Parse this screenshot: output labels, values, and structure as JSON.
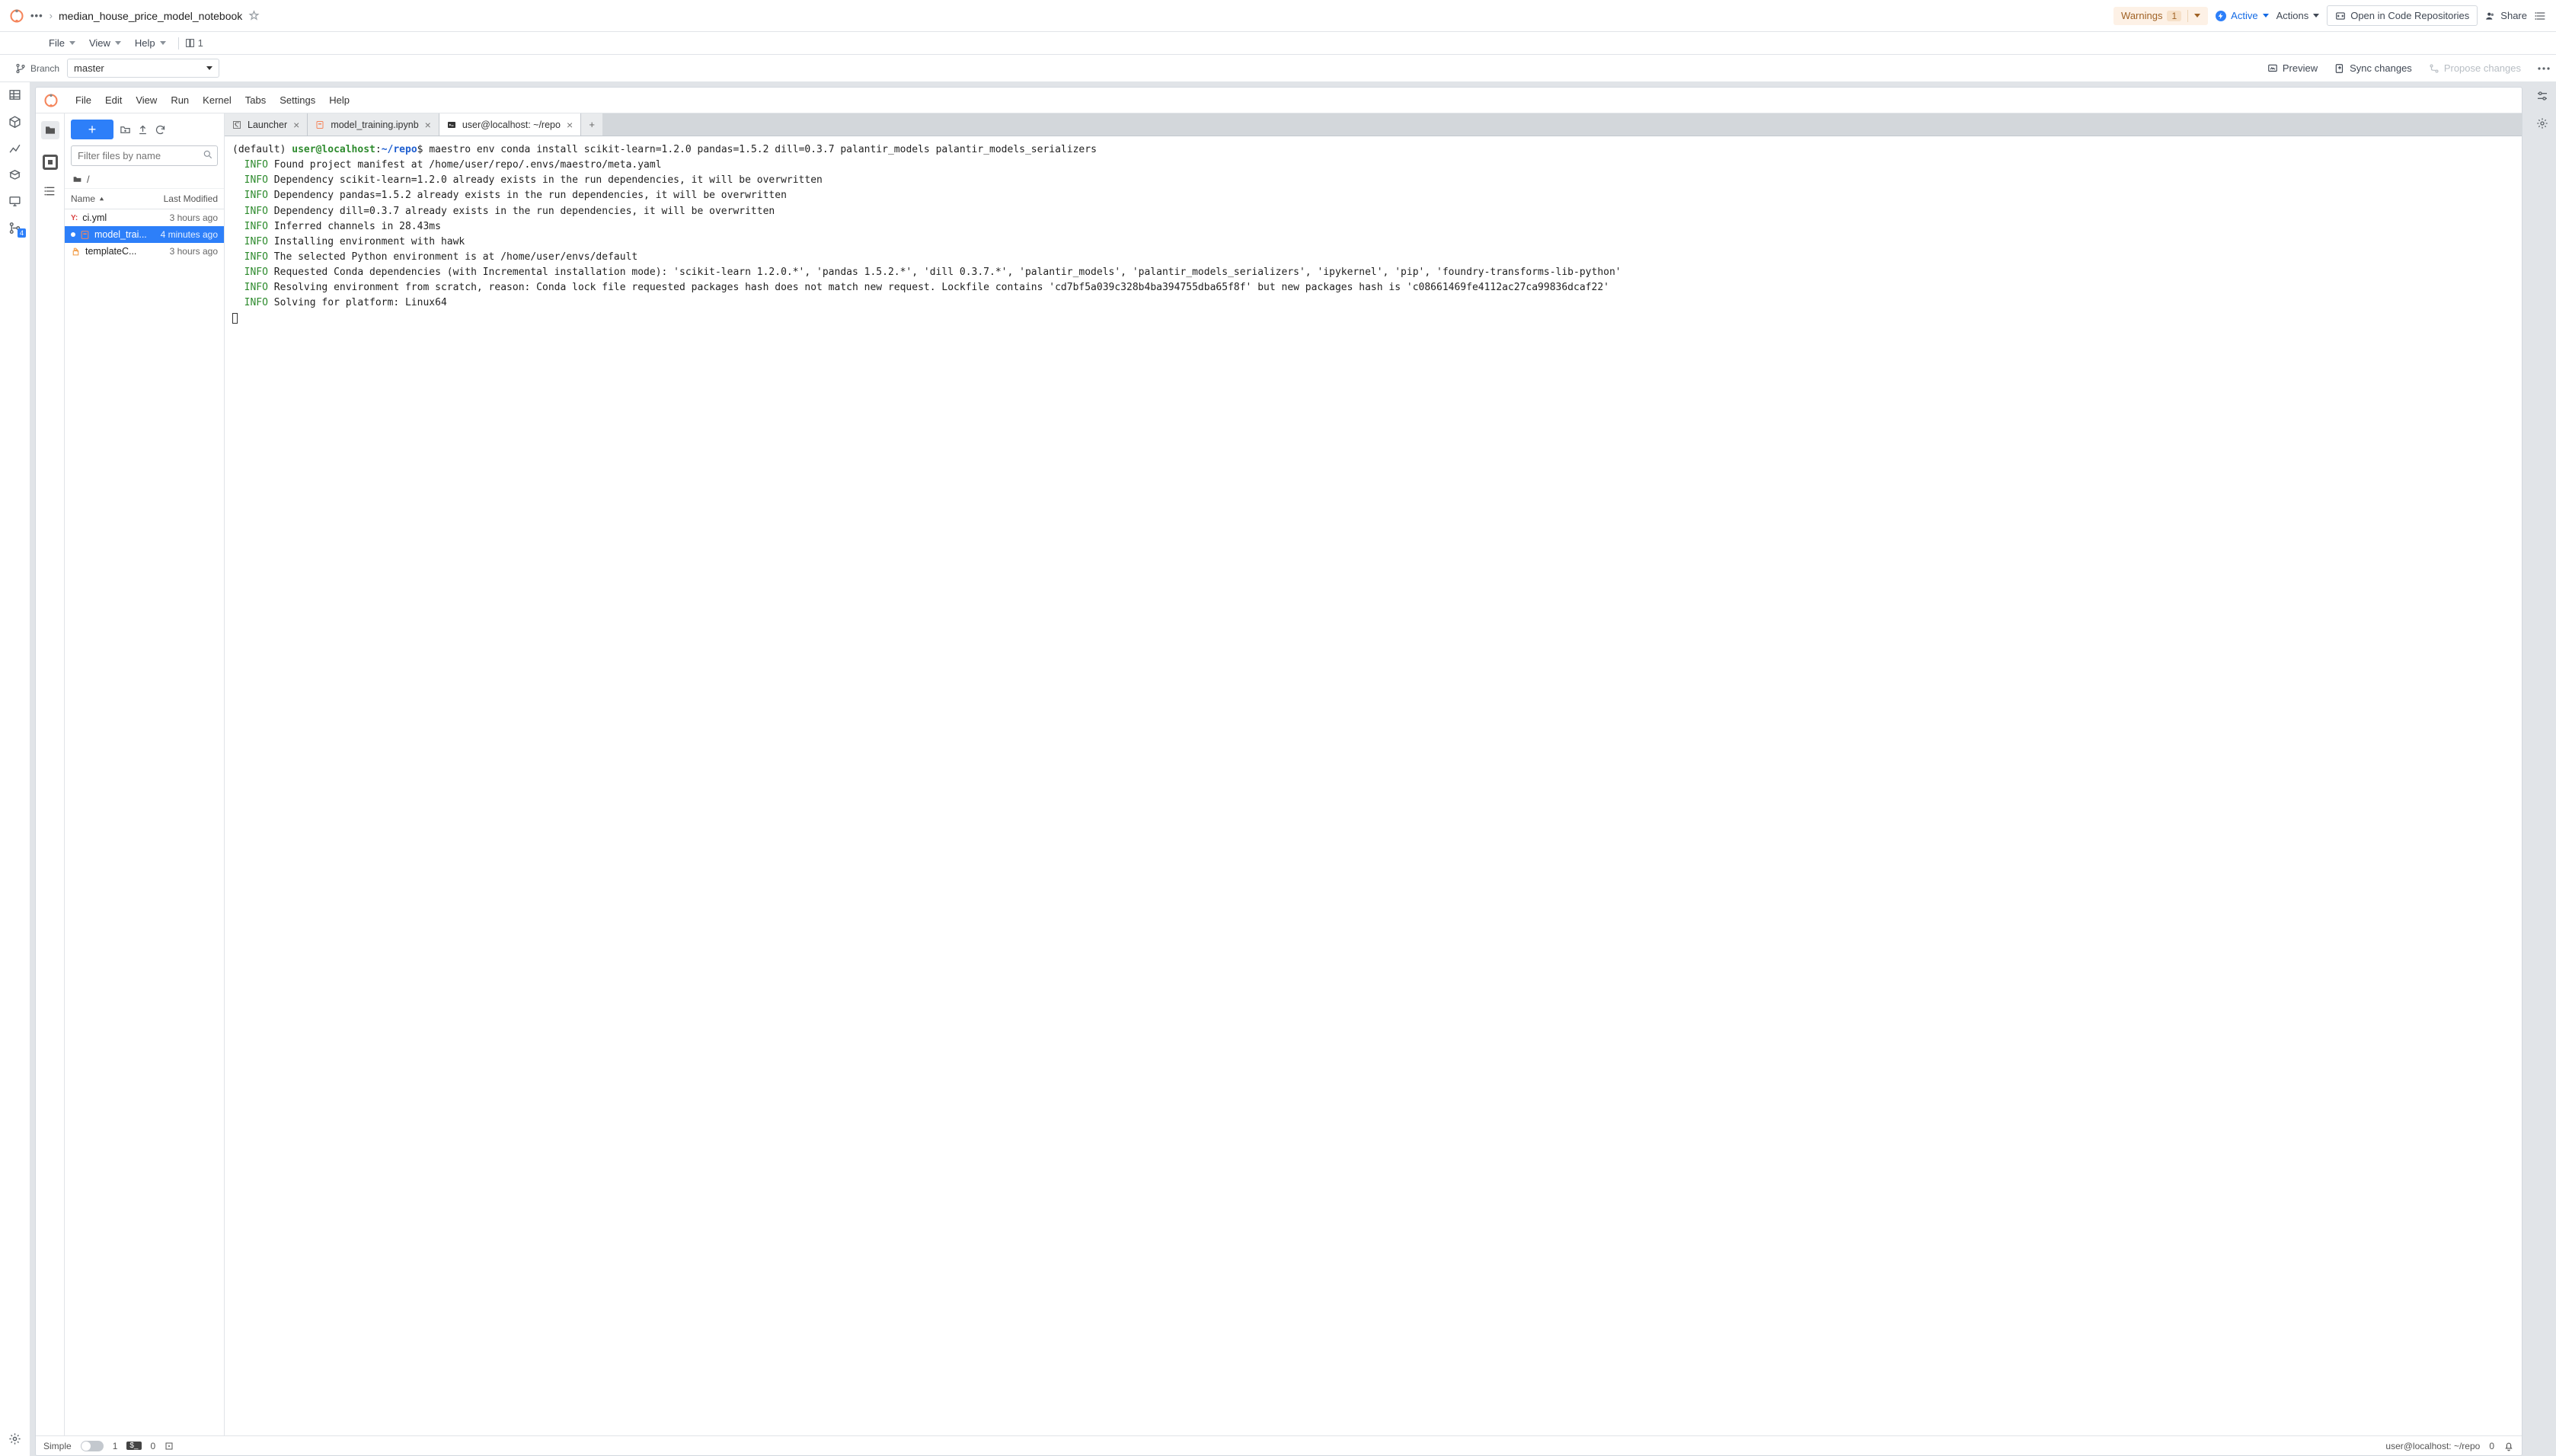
{
  "header": {
    "breadcrumb_ellipsis": "•••",
    "breadcrumb_sep": "›",
    "title": "median_house_price_model_notebook",
    "warnings_label": "Warnings",
    "warnings_count": "1",
    "active_label": "Active",
    "actions_label": "Actions",
    "open_repo_label": "Open in Code Repositories",
    "share_label": "Share"
  },
  "sub_menu": {
    "file": "File",
    "view": "View",
    "help": "Help",
    "panel_count": "1"
  },
  "branch_row": {
    "label": "Branch",
    "value": "master",
    "preview": "Preview",
    "sync": "Sync changes",
    "propose": "Propose changes"
  },
  "left_rail_badge": "4",
  "jupyter_menu": {
    "file": "File",
    "edit": "Edit",
    "view": "View",
    "run": "Run",
    "kernel": "Kernel",
    "tabs": "Tabs",
    "settings": "Settings",
    "help": "Help"
  },
  "file_browser": {
    "filter_placeholder": "Filter files by name",
    "path": "/",
    "col_name": "Name",
    "col_modified": "Last Modified",
    "files": [
      {
        "name": "ci.yml",
        "time": "3 hours ago",
        "type": "yml",
        "selected": false,
        "dirty": false
      },
      {
        "name": "model_trai...",
        "time": "4 minutes ago",
        "type": "nb",
        "selected": true,
        "dirty": true
      },
      {
        "name": "templateC...",
        "time": "3 hours ago",
        "type": "tpl",
        "selected": false,
        "dirty": false
      }
    ]
  },
  "tabs": [
    {
      "label": "Launcher",
      "icon": "launcher",
      "active": false
    },
    {
      "label": "model_training.ipynb",
      "icon": "notebook",
      "active": false
    },
    {
      "label": "user@localhost: ~/repo",
      "icon": "terminal",
      "active": true
    }
  ],
  "terminal": {
    "default_prefix": "(default) ",
    "user": "user@localhost",
    "colon": ":",
    "path": "~/repo",
    "prompt": "$",
    "command": "maestro env conda install scikit-learn=1.2.0 pandas=1.5.2 dill=0.3.7 palantir_models palantir_models_serializers",
    "lines": [
      "Found project manifest at /home/user/repo/.envs/maestro/meta.yaml",
      "Dependency scikit-learn=1.2.0 already exists in the run dependencies, it will be overwritten",
      "Dependency pandas=1.5.2 already exists in the run dependencies, it will be overwritten",
      "Dependency dill=0.3.7 already exists in the run dependencies, it will be overwritten",
      "Inferred channels in 28.43ms",
      "Installing environment with hawk",
      "The selected Python environment is at /home/user/envs/default",
      "Requested Conda dependencies (with Incremental installation mode): 'scikit-learn 1.2.0.*', 'pandas 1.5.2.*', 'dill 0.3.7.*', 'palantir_models', 'palantir_models_serializers', 'ipykernel', 'pip', 'foundry-transforms-lib-python'",
      "Resolving environment from scratch, reason: Conda lock file requested packages hash does not match new request. Lockfile contains 'cd7bf5a039c328b4ba394755dba65f8f' but new packages hash is 'c08661469fe4112ac27ca99836dcaf22'",
      "Solving for platform: Linux64"
    ],
    "info_tag": "INFO"
  },
  "statusbar": {
    "simple": "Simple",
    "num1": "1",
    "num0": "0",
    "right_text": "user@localhost: ~/repo",
    "right_zero": "0"
  }
}
